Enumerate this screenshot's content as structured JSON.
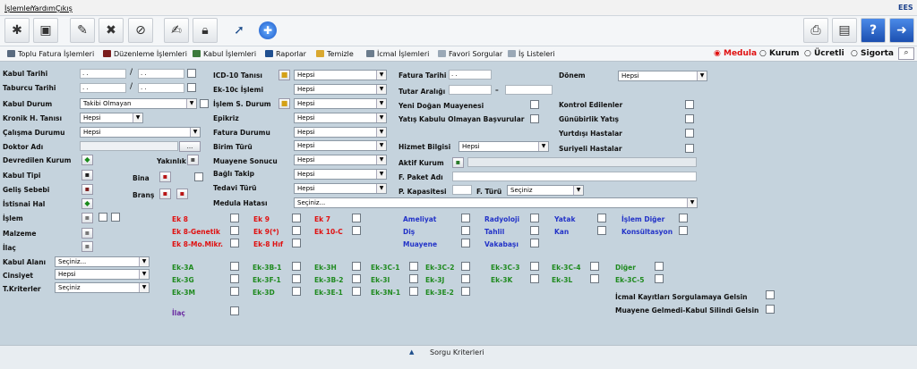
{
  "menu": {
    "islemler": "İşlemler",
    "yardim": "Yardım",
    "cikis": "Çıkış",
    "brand": "EES"
  },
  "secbar": {
    "toplu": "Toplu Fatura İşlemleri",
    "duzenleme": "Düzenleme İşlemleri",
    "kabul": "Kabul İşlemleri",
    "raporlar": "Raporlar",
    "temizle": "Temizle",
    "icmal": "İcmal İşlemleri",
    "favori": "Favori Sorgular",
    "is": "İş Listeleri"
  },
  "radios": {
    "medula": "Medula",
    "kurum": "Kurum",
    "ucretli": "Ücretli",
    "sigorta": "Sigorta"
  },
  "left": {
    "kabul_tarihi": "Kabul Tarihi",
    "taburcu_tarihi": "Taburcu Tarihi",
    "kabul_durum": "Kabul Durum",
    "kabul_durum_val": "Takibi Olmayan",
    "kronik": "Kronik H. Tanısı",
    "kronik_val": "Hepsi",
    "calisma": "Çalışma Durumu",
    "calisma_val": "Hepsi",
    "doktor": "Doktor Adı",
    "doktor_btn": "...",
    "devredilen": "Devredilen Kurum",
    "yakinlik": "Yakınlık",
    "kabul_tipi": "Kabul Tipi",
    "bina": "Bina",
    "gelis": "Geliş Sebebi",
    "brans": "Branş",
    "istisnai": "İstisnai Hal",
    "islem": "İşlem",
    "malzeme": "Malzeme",
    "ilac": "İlaç",
    "kabul_alani": "Kabul Alanı",
    "kabul_alani_val": "Seçiniz...",
    "cinsiyet": "Cinsiyet",
    "cinsiyet_val": "Hepsi",
    "tkriter": "T.Kriterler",
    "tkriter_val": "Seçiniz",
    "date_ph": "  .   .  "
  },
  "mid": {
    "icd": "ICD-10 Tanısı",
    "ek10c": "Ek-10c İşlemi",
    "islem_s": "İşlem S. Durum",
    "epikriz": "Epikriz",
    "fatura_d": "Fatura Durumu",
    "birim": "Birim Türü",
    "muayene": "Muayene Sonucu",
    "bagli": "Bağlı Takip",
    "tedavi": "Tedavi Türü",
    "medula_h": "Medula Hatası",
    "hepsi": "Hepsi",
    "seciniz_dots": "Seçiniz..."
  },
  "right": {
    "fatura_t": "Fatura Tarihi",
    "tutar": "Tutar Aralığı",
    "tutar_sep": "–",
    "yeni": "Yeni Doğan Muayenesi",
    "yatis": "Yatış Kabulu Olmayan Başvurular",
    "hizmet": "Hizmet Bilgisi",
    "hizmet_val": "Hepsi",
    "aktif": "Aktif Kurum",
    "fpaket": "F. Paket Adı",
    "pkap": "P. Kapasitesi",
    "fturu": "F. Türü",
    "fturu_val": "Seçiniz",
    "donem": "Dönem",
    "donem_val": "Hepsi",
    "kontrol": "Kontrol Edilenler",
    "gunubirlik": "Günübirlik Yatış",
    "yurtdisi": "Yurtdışı Hastalar",
    "suriyeli": "Suriyeli Hastalar"
  },
  "ek_red": [
    "Ek 8",
    "Ek 9",
    "Ek 7",
    "Ek 8-Genetik",
    "Ek 9(*)",
    "Ek 10-C",
    "Ek 8-Mo.Mikr.",
    "Ek-8 Hıf"
  ],
  "ek_blue": [
    "Ameliyat",
    "Radyoloji",
    "Yatak",
    "İşlem Diğer",
    "Diş",
    "Tahlil",
    "Kan",
    "Konsültasyon",
    "Muayene",
    "Vakabaşı"
  ],
  "ek_green": [
    "Ek-3A",
    "Ek-3B-1",
    "Ek-3H",
    "Ek-3C-1",
    "Ek-3C-2",
    "Ek-3C-3",
    "Ek-3C-4",
    "Diğer",
    "Ek-3G",
    "Ek-3F-1",
    "Ek-3B-2",
    "Ek-3I",
    "Ek-3J",
    "Ek-3K",
    "Ek-3L",
    "Ek-3C-5",
    "Ek-3M",
    "Ek-3D",
    "Ek-3E-1",
    "Ek-3N-1",
    "Ek-3E-2"
  ],
  "ilac2": "İlaç",
  "icmal_k": "İcmal Kayıtları Sorgulamaya Gelsin",
  "muayene_g": "Muayene Gelmedi-Kabul Silindi Gelsin",
  "footer": "Sorgu Kriterleri",
  "colors": {
    "bg": "#c5d3dd",
    "red": "#e01010",
    "blue": "#2333c8",
    "green": "#1f8a1f"
  }
}
